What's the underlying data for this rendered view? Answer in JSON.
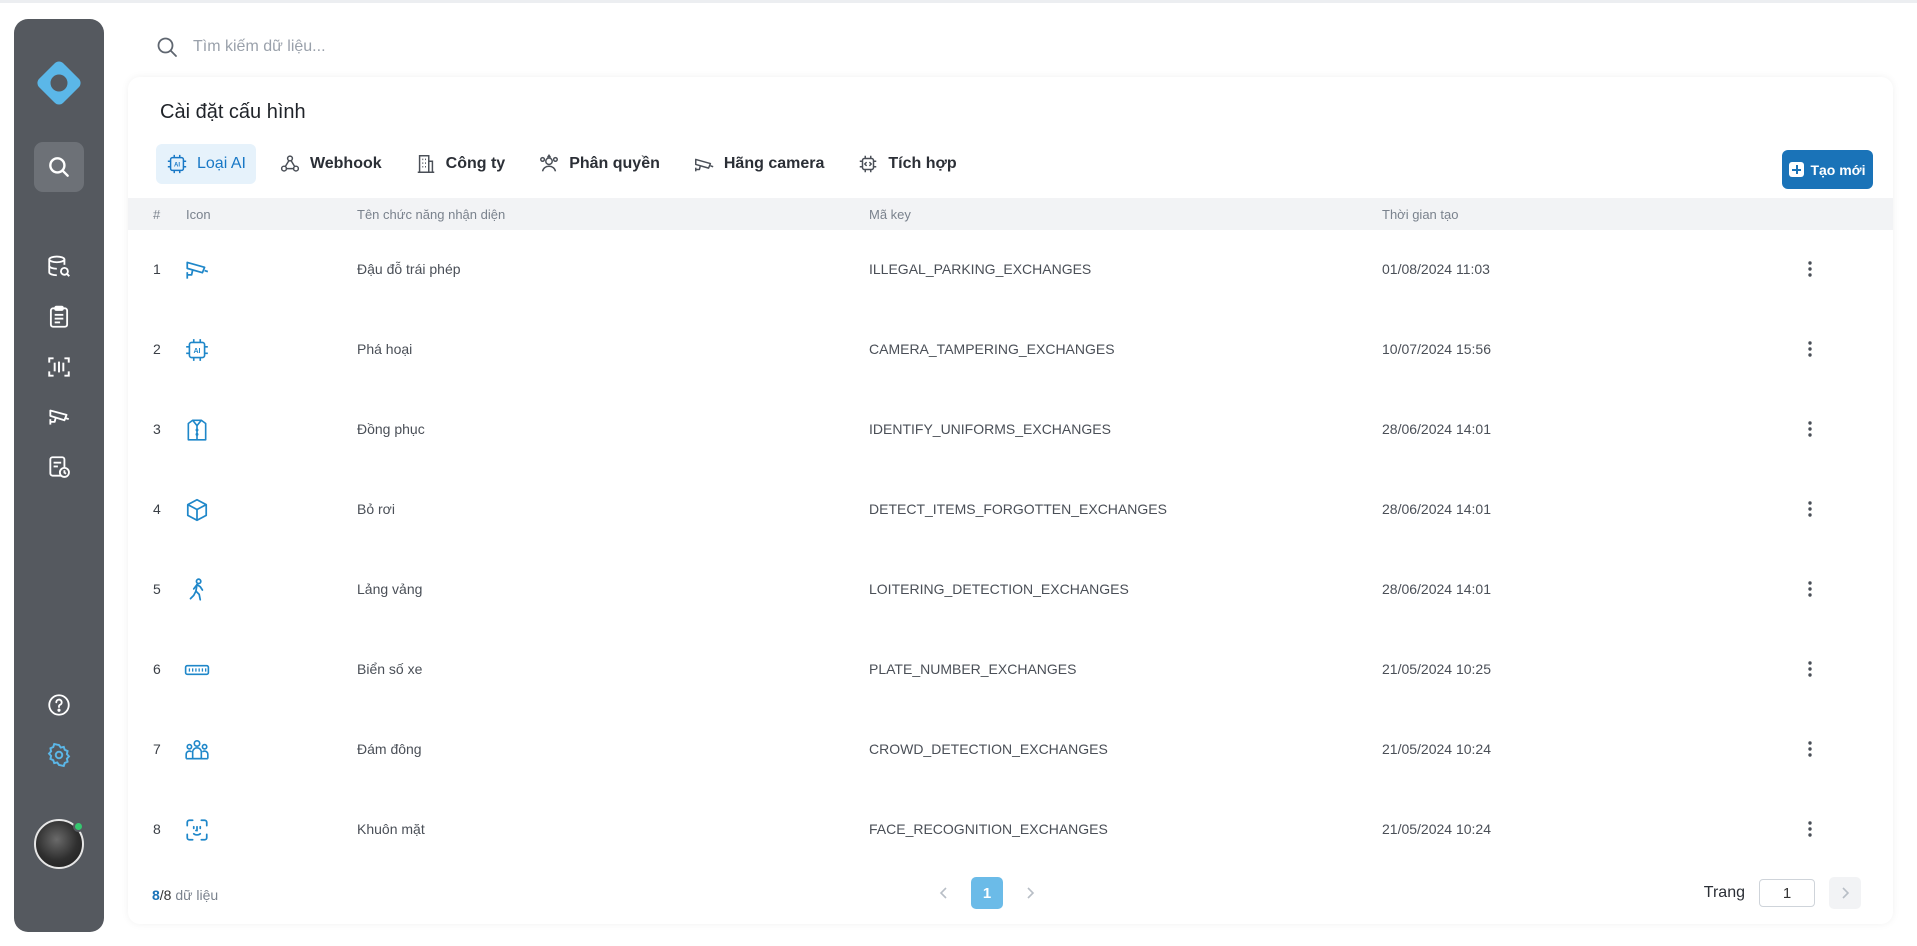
{
  "search": {
    "placeholder": "Tìm kiếm dữ liệu..."
  },
  "sidebar": {
    "logo": "logo-icon",
    "items": [
      {
        "icon": "search-icon",
        "active": true
      },
      {
        "icon": "database-search-icon"
      },
      {
        "icon": "clipboard-icon"
      },
      {
        "icon": "scan-icon"
      },
      {
        "icon": "cctv-camera-icon"
      },
      {
        "icon": "report-clock-icon"
      },
      {
        "icon": "help-icon"
      },
      {
        "icon": "settings-icon"
      }
    ],
    "accent": "#5bb7e8"
  },
  "page": {
    "title": "Cài đặt cấu hình"
  },
  "tabs": [
    {
      "label": "Loại AI",
      "icon": "ai-chip-icon",
      "active": true
    },
    {
      "label": "Webhook",
      "icon": "webhook-icon"
    },
    {
      "label": "Công ty",
      "icon": "building-icon"
    },
    {
      "label": "Phân quyền",
      "icon": "user-group-icon"
    },
    {
      "label": "Hãng camera",
      "icon": "camera-icon"
    },
    {
      "label": "Tích hợp",
      "icon": "integration-icon"
    }
  ],
  "create_button": {
    "label": "Tạo mới"
  },
  "table": {
    "columns": {
      "index": "#",
      "icon": "Icon",
      "name": "Tên chức năng nhận diện",
      "key": "Mã key",
      "created": "Thời gian tạo"
    },
    "rows": [
      {
        "index": "1",
        "icon": "cctv-camera-icon",
        "name": "Đậu đỗ trái phép",
        "key": "ILLEGAL_PARKING_EXCHANGES",
        "created": "01/08/2024 11:03"
      },
      {
        "index": "2",
        "icon": "ai-chip-icon",
        "name": "Phá hoại",
        "key": "CAMERA_TAMPERING_EXCHANGES",
        "created": "10/07/2024 15:56"
      },
      {
        "index": "3",
        "icon": "uniform-icon",
        "name": "Đồng phục",
        "key": "IDENTIFY_UNIFORMS_EXCHANGES",
        "created": "28/06/2024 14:01"
      },
      {
        "index": "4",
        "icon": "box-icon",
        "name": "Bỏ rơi",
        "key": "DETECT_ITEMS_FORGOTTEN_EXCHANGES",
        "created": "28/06/2024 14:01"
      },
      {
        "index": "5",
        "icon": "walking-person-icon",
        "name": "Lảng vảng",
        "key": "LOITERING_DETECTION_EXCHANGES",
        "created": "28/06/2024 14:01"
      },
      {
        "index": "6",
        "icon": "license-plate-icon",
        "name": "Biển số xe",
        "key": "PLATE_NUMBER_EXCHANGES",
        "created": "21/05/2024 10:25"
      },
      {
        "index": "7",
        "icon": "crowd-icon",
        "name": "Đám đông",
        "key": "CROWD_DETECTION_EXCHANGES",
        "created": "21/05/2024 10:24"
      },
      {
        "index": "8",
        "icon": "face-scan-icon",
        "name": "Khuôn mặt",
        "key": "FACE_RECOGNITION_EXCHANGES",
        "created": "21/05/2024 10:24"
      }
    ]
  },
  "footer": {
    "shown": "8",
    "total": "/8",
    "suffix": " dữ liệu",
    "current_page": "1",
    "goto_label": "Trang",
    "goto_value": "1"
  },
  "colors": {
    "primary": "#1a73b8",
    "sidebar": "#55595f",
    "icon_blue": "#1f87c9"
  }
}
